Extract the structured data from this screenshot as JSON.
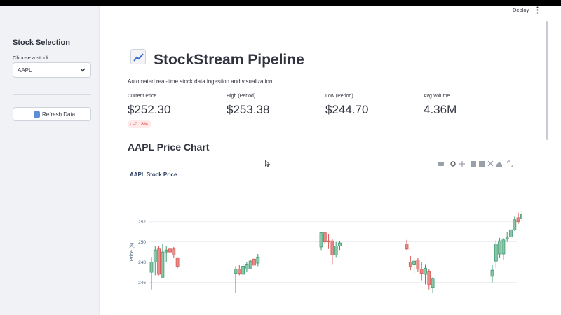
{
  "sidebar": {
    "title": "Stock Selection",
    "select_label": "Choose a stock:",
    "selected": "AAPL",
    "refresh_label": "Refresh Data"
  },
  "header": {
    "deploy": "Deploy"
  },
  "app": {
    "title": "StockStream Pipeline",
    "subtitle": "Automated real-time stock data ingestion and visualization"
  },
  "metrics": [
    {
      "label": "Current Price",
      "value": "$252.30"
    },
    {
      "label": "High (Period)",
      "value": "$253.38"
    },
    {
      "label": "Low (Period)",
      "value": "$244.70"
    },
    {
      "label": "Avg Volume",
      "value": "4.36M"
    }
  ],
  "delta": {
    "text": "-0.18%",
    "color": "#d32f2f"
  },
  "section_title": "AAPL Price Chart",
  "chart_data": {
    "type": "candlestick",
    "title": "AAPL Stock Price",
    "ylabel": "Price ($)",
    "ylim": [
      245,
      253.5
    ],
    "yticks": [
      246,
      248,
      250,
      252
    ],
    "grid": true,
    "up_color": "#3d9970",
    "down_color": "#d9534f",
    "series": [
      {
        "o": 247.0,
        "h": 248.5,
        "l": 245.3,
        "c": 248.0
      },
      {
        "o": 248.0,
        "h": 249.6,
        "l": 246.7,
        "c": 249.2
      },
      {
        "o": 249.3,
        "h": 249.6,
        "l": 246.7,
        "c": 246.8
      },
      {
        "o": 246.5,
        "h": 249.8,
        "l": 246.5,
        "c": 249.0
      },
      {
        "o": 249.0,
        "h": 249.6,
        "l": 248.0,
        "c": 249.2
      },
      {
        "o": 249.3,
        "h": 249.6,
        "l": 248.9,
        "c": 249.0
      },
      {
        "o": 249.3,
        "h": 249.5,
        "l": 248.4,
        "c": 248.7
      },
      {
        "o": 248.4,
        "h": 248.5,
        "l": 247.4,
        "c": 247.6
      },
      {
        "o": 246.9,
        "h": 247.6,
        "l": 245.0,
        "c": 247.3
      },
      {
        "o": 247.3,
        "h": 247.7,
        "l": 246.7,
        "c": 246.9
      },
      {
        "o": 246.8,
        "h": 247.8,
        "l": 246.8,
        "c": 247.6
      },
      {
        "o": 247.3,
        "h": 248.0,
        "l": 247.0,
        "c": 247.8
      },
      {
        "o": 247.4,
        "h": 248.2,
        "l": 247.4,
        "c": 248.1
      },
      {
        "o": 248.3,
        "h": 248.3,
        "l": 247.7,
        "c": 247.7
      },
      {
        "o": 247.9,
        "h": 248.8,
        "l": 247.6,
        "c": 248.5
      },
      {
        "o": 249.5,
        "h": 251.0,
        "l": 249.2,
        "c": 250.9
      },
      {
        "o": 250.9,
        "h": 251.0,
        "l": 249.8,
        "c": 250.0
      },
      {
        "o": 250.1,
        "h": 250.8,
        "l": 249.3,
        "c": 250.0
      },
      {
        "o": 250.1,
        "h": 250.3,
        "l": 247.8,
        "c": 248.7
      },
      {
        "o": 248.7,
        "h": 250.0,
        "l": 248.5,
        "c": 249.6
      },
      {
        "o": 249.6,
        "h": 250.1,
        "l": 249.2,
        "c": 249.9
      },
      {
        "o": 249.8,
        "h": 250.2,
        "l": 249.2,
        "c": 249.3
      },
      {
        "o": 248.0,
        "h": 248.6,
        "l": 247.2,
        "c": 247.6
      },
      {
        "o": 247.8,
        "h": 248.3,
        "l": 246.8,
        "c": 248.1
      },
      {
        "o": 248.2,
        "h": 248.4,
        "l": 247.0,
        "c": 247.3
      },
      {
        "o": 247.3,
        "h": 248.0,
        "l": 246.2,
        "c": 246.9
      },
      {
        "o": 246.8,
        "h": 247.8,
        "l": 245.8,
        "c": 247.4
      },
      {
        "o": 247.1,
        "h": 247.3,
        "l": 245.3,
        "c": 245.8
      },
      {
        "o": 245.5,
        "h": 246.5,
        "l": 245.0,
        "c": 246.4
      },
      {
        "o": 246.6,
        "h": 247.7,
        "l": 246.0,
        "c": 247.2
      },
      {
        "o": 248.1,
        "h": 250.2,
        "l": 247.4,
        "c": 249.8
      },
      {
        "o": 248.8,
        "h": 250.4,
        "l": 248.4,
        "c": 250.1
      },
      {
        "o": 248.8,
        "h": 250.4,
        "l": 248.2,
        "c": 250.2
      },
      {
        "o": 250.3,
        "h": 251.0,
        "l": 250.0,
        "c": 250.4
      },
      {
        "o": 250.5,
        "h": 251.5,
        "l": 250.0,
        "c": 251.2
      },
      {
        "o": 251.2,
        "h": 252.5,
        "l": 251.1,
        "c": 252.2
      },
      {
        "o": 252.4,
        "h": 252.9,
        "l": 251.8,
        "c": 252.0
      },
      {
        "o": 252.3,
        "h": 253.0,
        "l": 252.0,
        "c": 252.7
      }
    ]
  }
}
